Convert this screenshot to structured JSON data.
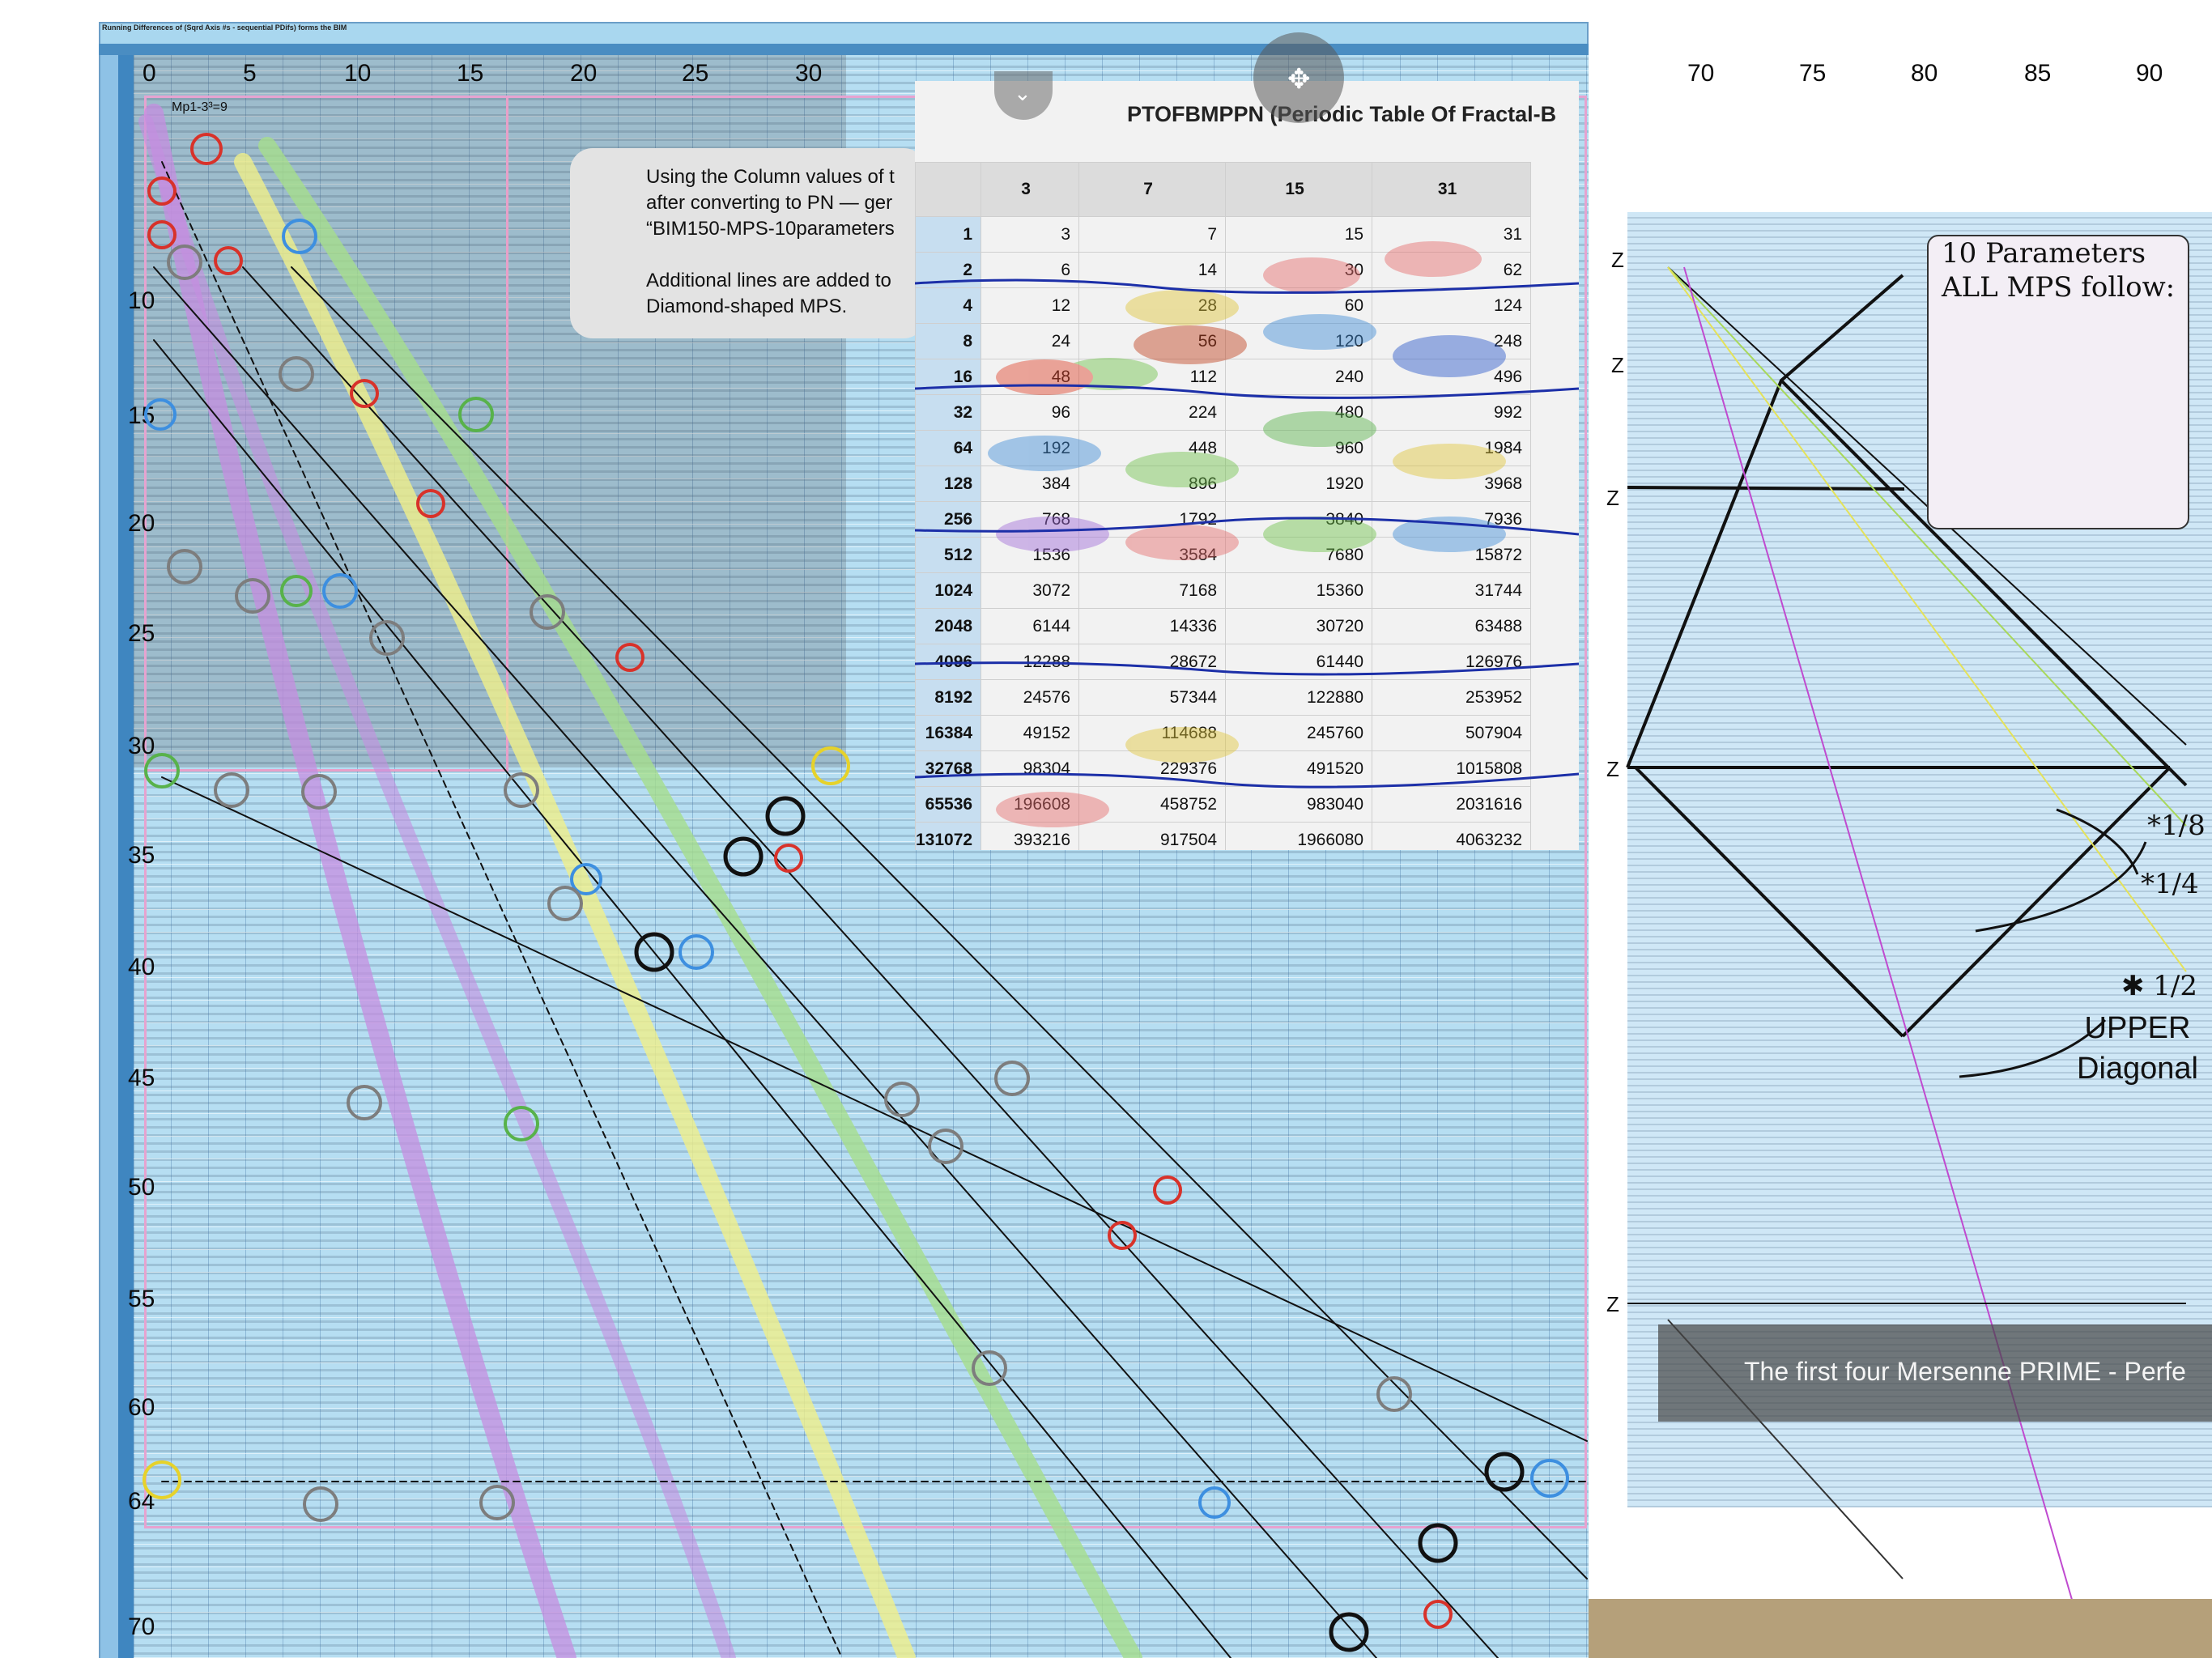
{
  "sheet": {
    "title": "Running Differences of (Sqrd Axis #s - sequential PDifs) forms the BIM",
    "cell_label": "Mp1-3³=9",
    "column_labels": [
      "0",
      "5",
      "10",
      "15",
      "20",
      "25",
      "30",
      "70",
      "75",
      "80",
      "85",
      "90"
    ],
    "row_labels": [
      "10",
      "15",
      "20",
      "25",
      "30",
      "35",
      "40",
      "45",
      "50",
      "55",
      "60",
      "64",
      "70"
    ]
  },
  "popover": {
    "line1": "Using the Column values of t",
    "line2": "after converting to PN — ger",
    "line3": "“BIM150-MPS-10parameters",
    "line4": "Additional lines are added to",
    "line5": "Diamond-shaped MPS."
  },
  "table_panel": {
    "title": "PTOFBMPPN (Periodic Table Of Fractal-B",
    "headers": [
      "",
      "3",
      "7",
      "15",
      "31"
    ],
    "rows": [
      [
        "1",
        "3",
        "7",
        "15",
        "31"
      ],
      [
        "2",
        "6",
        "14",
        "30",
        "62"
      ],
      [
        "4",
        "12",
        "28",
        "60",
        "124"
      ],
      [
        "8",
        "24",
        "56",
        "120",
        "248"
      ],
      [
        "16",
        "48",
        "112",
        "240",
        "496"
      ],
      [
        "32",
        "96",
        "224",
        "480",
        "992"
      ],
      [
        "64",
        "192",
        "448",
        "960",
        "1984"
      ],
      [
        "128",
        "384",
        "896",
        "1920",
        "3968"
      ],
      [
        "256",
        "768",
        "1792",
        "3840",
        "7936"
      ],
      [
        "512",
        "1536",
        "3584",
        "7680",
        "15872"
      ],
      [
        "1024",
        "3072",
        "7168",
        "15360",
        "31744"
      ],
      [
        "2048",
        "6144",
        "14336",
        "30720",
        "63488"
      ],
      [
        "4096",
        "12288",
        "28672",
        "61440",
        "126976"
      ],
      [
        "8192",
        "24576",
        "57344",
        "122880",
        "253952"
      ],
      [
        "16384",
        "49152",
        "114688",
        "245760",
        "507904"
      ],
      [
        "32768",
        "98304",
        "229376",
        "491520",
        "1015808"
      ],
      [
        "65536",
        "196608",
        "458752",
        "983040",
        "2031616"
      ],
      [
        "131072",
        "393216",
        "917504",
        "1966080",
        "4063232"
      ]
    ]
  },
  "right_diagram": {
    "params_title_1": "10 Parameters",
    "params_title_2": "ALL MPS follow:",
    "frac_1_8": "*1/8",
    "frac_1_4": "*1/4",
    "frac_1_2": "✱ 1/2",
    "upper_1": "UPPER",
    "upper_2": "Diagonal",
    "mersenne": "The first four Mersenne PRIME - Perfe",
    "z_label": "Z"
  },
  "colors": {
    "sheet_bg": "#a9d7ef",
    "header_blue": "#4a8dc2",
    "purple_band": "#c58ee0",
    "yellow_band": "#f0ef8a",
    "green_band": "#a6dd8c",
    "circle_gray": "#8a8a8a",
    "circle_red": "#d8322a",
    "circle_blue": "#3d8fe0",
    "circle_green": "#58b24a"
  },
  "icons": [
    "arrows-move-icon",
    "chevron-down-icon"
  ]
}
